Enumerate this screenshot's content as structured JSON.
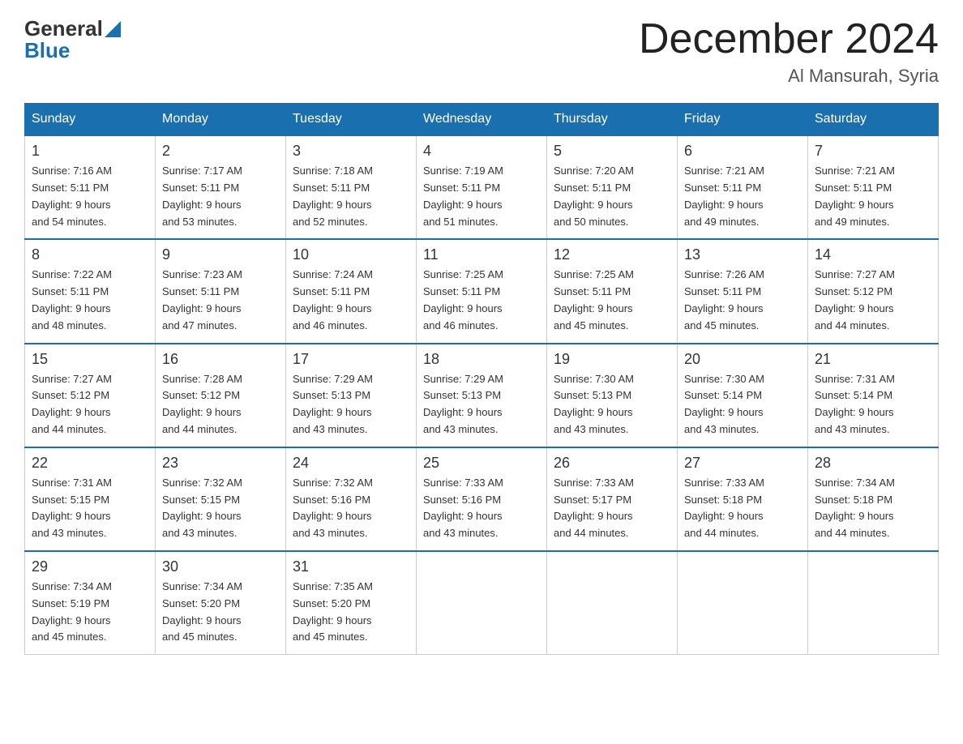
{
  "header": {
    "logo_general": "General",
    "logo_blue": "Blue",
    "month_year": "December 2024",
    "location": "Al Mansurah, Syria"
  },
  "days_of_week": [
    "Sunday",
    "Monday",
    "Tuesday",
    "Wednesday",
    "Thursday",
    "Friday",
    "Saturday"
  ],
  "weeks": [
    [
      {
        "day": "1",
        "sunrise": "7:16 AM",
        "sunset": "5:11 PM",
        "daylight": "9 hours and 54 minutes."
      },
      {
        "day": "2",
        "sunrise": "7:17 AM",
        "sunset": "5:11 PM",
        "daylight": "9 hours and 53 minutes."
      },
      {
        "day": "3",
        "sunrise": "7:18 AM",
        "sunset": "5:11 PM",
        "daylight": "9 hours and 52 minutes."
      },
      {
        "day": "4",
        "sunrise": "7:19 AM",
        "sunset": "5:11 PM",
        "daylight": "9 hours and 51 minutes."
      },
      {
        "day": "5",
        "sunrise": "7:20 AM",
        "sunset": "5:11 PM",
        "daylight": "9 hours and 50 minutes."
      },
      {
        "day": "6",
        "sunrise": "7:21 AM",
        "sunset": "5:11 PM",
        "daylight": "9 hours and 49 minutes."
      },
      {
        "day": "7",
        "sunrise": "7:21 AM",
        "sunset": "5:11 PM",
        "daylight": "9 hours and 49 minutes."
      }
    ],
    [
      {
        "day": "8",
        "sunrise": "7:22 AM",
        "sunset": "5:11 PM",
        "daylight": "9 hours and 48 minutes."
      },
      {
        "day": "9",
        "sunrise": "7:23 AM",
        "sunset": "5:11 PM",
        "daylight": "9 hours and 47 minutes."
      },
      {
        "day": "10",
        "sunrise": "7:24 AM",
        "sunset": "5:11 PM",
        "daylight": "9 hours and 46 minutes."
      },
      {
        "day": "11",
        "sunrise": "7:25 AM",
        "sunset": "5:11 PM",
        "daylight": "9 hours and 46 minutes."
      },
      {
        "day": "12",
        "sunrise": "7:25 AM",
        "sunset": "5:11 PM",
        "daylight": "9 hours and 45 minutes."
      },
      {
        "day": "13",
        "sunrise": "7:26 AM",
        "sunset": "5:11 PM",
        "daylight": "9 hours and 45 minutes."
      },
      {
        "day": "14",
        "sunrise": "7:27 AM",
        "sunset": "5:12 PM",
        "daylight": "9 hours and 44 minutes."
      }
    ],
    [
      {
        "day": "15",
        "sunrise": "7:27 AM",
        "sunset": "5:12 PM",
        "daylight": "9 hours and 44 minutes."
      },
      {
        "day": "16",
        "sunrise": "7:28 AM",
        "sunset": "5:12 PM",
        "daylight": "9 hours and 44 minutes."
      },
      {
        "day": "17",
        "sunrise": "7:29 AM",
        "sunset": "5:13 PM",
        "daylight": "9 hours and 43 minutes."
      },
      {
        "day": "18",
        "sunrise": "7:29 AM",
        "sunset": "5:13 PM",
        "daylight": "9 hours and 43 minutes."
      },
      {
        "day": "19",
        "sunrise": "7:30 AM",
        "sunset": "5:13 PM",
        "daylight": "9 hours and 43 minutes."
      },
      {
        "day": "20",
        "sunrise": "7:30 AM",
        "sunset": "5:14 PM",
        "daylight": "9 hours and 43 minutes."
      },
      {
        "day": "21",
        "sunrise": "7:31 AM",
        "sunset": "5:14 PM",
        "daylight": "9 hours and 43 minutes."
      }
    ],
    [
      {
        "day": "22",
        "sunrise": "7:31 AM",
        "sunset": "5:15 PM",
        "daylight": "9 hours and 43 minutes."
      },
      {
        "day": "23",
        "sunrise": "7:32 AM",
        "sunset": "5:15 PM",
        "daylight": "9 hours and 43 minutes."
      },
      {
        "day": "24",
        "sunrise": "7:32 AM",
        "sunset": "5:16 PM",
        "daylight": "9 hours and 43 minutes."
      },
      {
        "day": "25",
        "sunrise": "7:33 AM",
        "sunset": "5:16 PM",
        "daylight": "9 hours and 43 minutes."
      },
      {
        "day": "26",
        "sunrise": "7:33 AM",
        "sunset": "5:17 PM",
        "daylight": "9 hours and 44 minutes."
      },
      {
        "day": "27",
        "sunrise": "7:33 AM",
        "sunset": "5:18 PM",
        "daylight": "9 hours and 44 minutes."
      },
      {
        "day": "28",
        "sunrise": "7:34 AM",
        "sunset": "5:18 PM",
        "daylight": "9 hours and 44 minutes."
      }
    ],
    [
      {
        "day": "29",
        "sunrise": "7:34 AM",
        "sunset": "5:19 PM",
        "daylight": "9 hours and 45 minutes."
      },
      {
        "day": "30",
        "sunrise": "7:34 AM",
        "sunset": "5:20 PM",
        "daylight": "9 hours and 45 minutes."
      },
      {
        "day": "31",
        "sunrise": "7:35 AM",
        "sunset": "5:20 PM",
        "daylight": "9 hours and 45 minutes."
      },
      null,
      null,
      null,
      null
    ]
  ],
  "labels": {
    "sunrise": "Sunrise:",
    "sunset": "Sunset:",
    "daylight": "Daylight:"
  }
}
